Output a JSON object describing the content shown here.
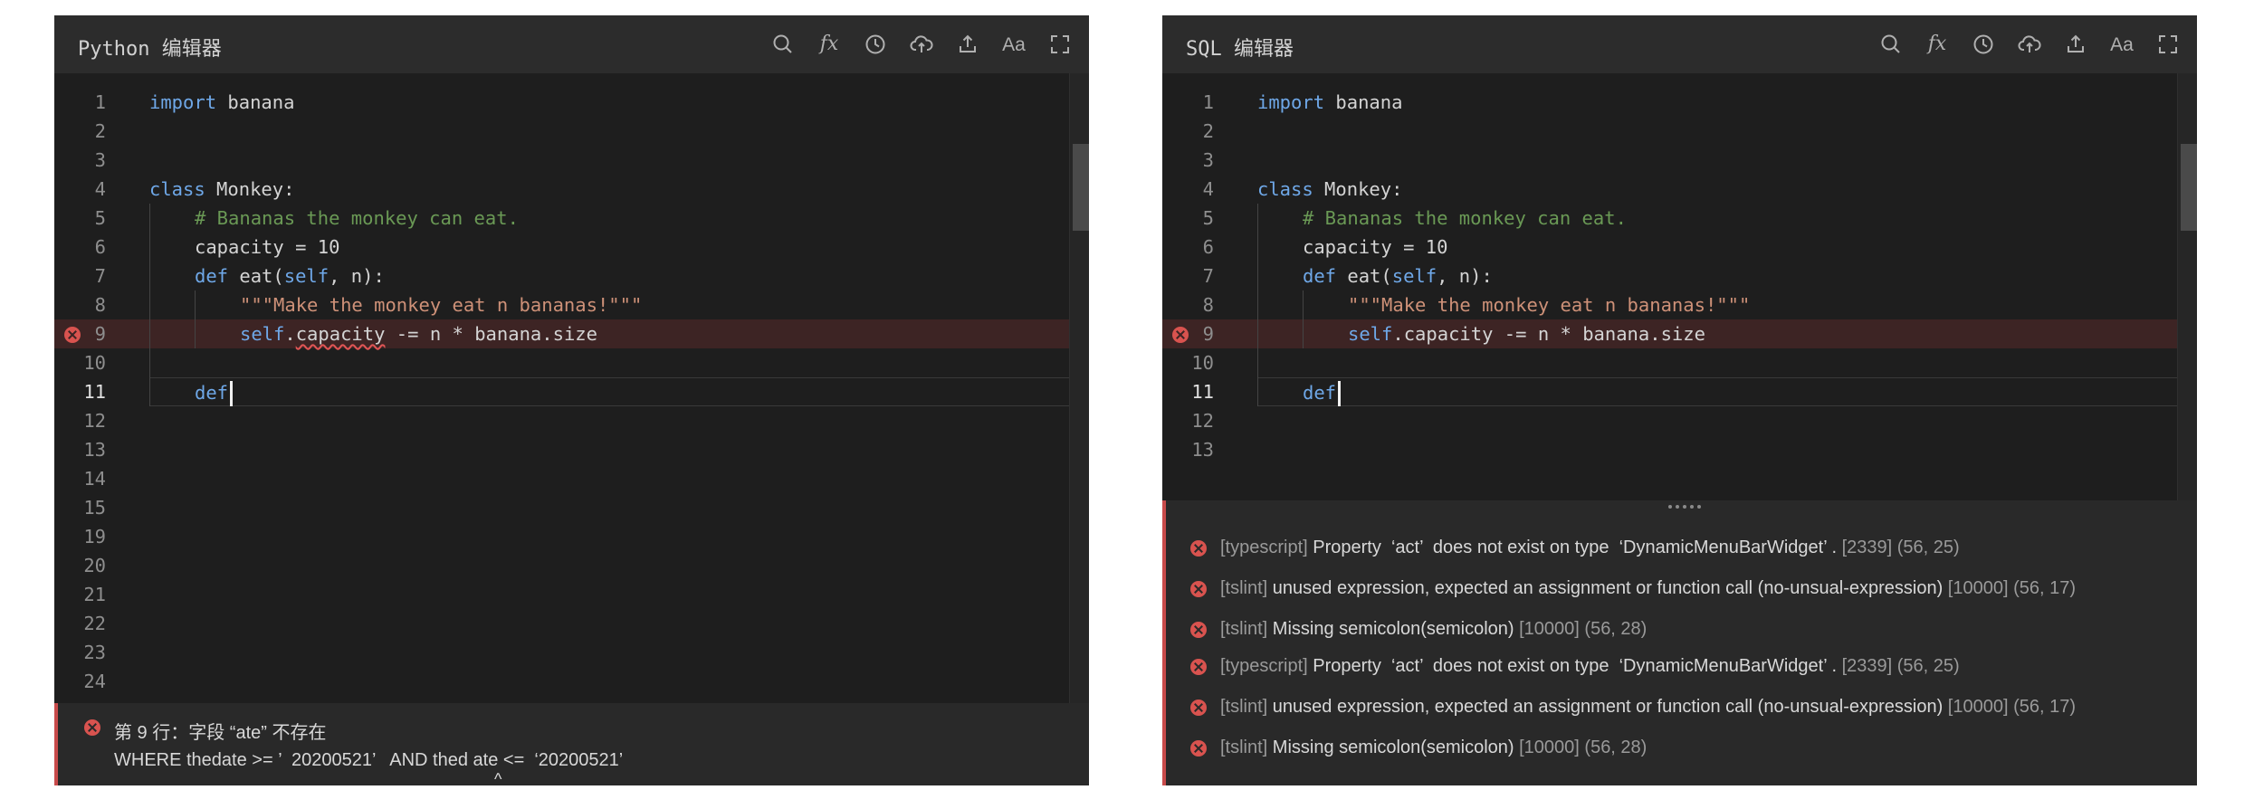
{
  "editors": {
    "python": {
      "title": "Python 编辑器",
      "lines": {
        "l1": {
          "num": "1",
          "kw": "import",
          "rest": " banana"
        },
        "l2": {
          "num": "2"
        },
        "l3": {
          "num": "3"
        },
        "l4": {
          "num": "4",
          "kw": "class",
          "rest": " Monkey:"
        },
        "l5": {
          "num": "5",
          "comment": "# Bananas the monkey can eat."
        },
        "l6": {
          "num": "6",
          "text": "capacity = 10"
        },
        "l7": {
          "num": "7",
          "kw": "def",
          "rest": " eat(",
          "self": "self",
          "rest2": ", n):"
        },
        "l8": {
          "num": "8",
          "string": "\"\"\"Make the monkey eat n bananas!\"\"\""
        },
        "l9": {
          "num": "9",
          "self": "self",
          "dot": ".",
          "err_word": "capacity",
          "rest": " -= n * banana.size"
        },
        "l10": {
          "num": "10"
        },
        "l11": {
          "num": "11",
          "kw": "def"
        },
        "l12": {
          "num": "12"
        },
        "l13": {
          "num": "13"
        },
        "l14": {
          "num": "14"
        },
        "l15": {
          "num": "15"
        },
        "l19": {
          "num": "19"
        },
        "l20": {
          "num": "20"
        },
        "l21": {
          "num": "21"
        },
        "l22": {
          "num": "22"
        },
        "l23": {
          "num": "23"
        },
        "l24": {
          "num": "24"
        }
      },
      "error_status": {
        "title": "第 9 行：字段 “ate” 不存在",
        "sql": "WHERE thedate >= ’  20200521’   AND thed ate <=  ‘20200521’",
        "caret": "^"
      }
    },
    "sql": {
      "title": "SQL 编辑器",
      "lines": {
        "l1": {
          "num": "1",
          "kw": "import",
          "rest": " banana"
        },
        "l2": {
          "num": "2"
        },
        "l3": {
          "num": "3"
        },
        "l4": {
          "num": "4",
          "kw": "class",
          "rest": " Monkey:"
        },
        "l5": {
          "num": "5",
          "comment": "# Bananas the monkey can eat."
        },
        "l6": {
          "num": "6",
          "text": "capacity = 10"
        },
        "l7": {
          "num": "7",
          "kw": "def",
          "rest": " eat(",
          "self": "self",
          "rest2": ", n):"
        },
        "l8": {
          "num": "8",
          "string": "\"\"\"Make the monkey eat n bananas!\"\"\""
        },
        "l9": {
          "num": "9",
          "self": "self",
          "rest": ".capacity -= n * banana.size"
        },
        "l10": {
          "num": "10"
        },
        "l11": {
          "num": "11",
          "kw": "def"
        },
        "l12": {
          "num": "12"
        },
        "l13": {
          "num": "13"
        }
      },
      "problems": [
        {
          "source": "[typescript]",
          "message": " Property  ‘act’  does not exist on type  ‘DynamicMenuBarWidget’ .",
          "code": " [2339] (56, 25)"
        },
        {
          "source": "[tslint]",
          "message": " unused expression, expected an assignment or function call (no-unsual-expression)",
          "code": " [10000] (56, 17)"
        },
        {
          "source": "[tslint]",
          "message": " Missing semicolon(semicolon)",
          "code": " [10000] (56, 28)"
        },
        {
          "source": "[typescript]",
          "message": " Property  ‘act’  does not exist on type  ‘DynamicMenuBarWidget’ .",
          "code": " [2339] (56, 25)"
        },
        {
          "source": "[tslint]",
          "message": " unused expression, expected an assignment or function call (no-unsual-expression)",
          "code": " [10000] (56, 17)"
        },
        {
          "source": "[tslint]",
          "message": " Missing semicolon(semicolon)",
          "code": " [10000] (56, 28)"
        }
      ]
    }
  },
  "toolbar": {
    "icons": [
      "search-icon",
      "function-icon",
      "history-icon",
      "cloud-upload-icon",
      "upload-icon",
      "font-size-icon",
      "fullscreen-icon"
    ],
    "fx_glyph": "fx",
    "aa_label": "Aa"
  },
  "colors": {
    "keyword": "#6fa8e8",
    "comment": "#6a9955",
    "string": "#ce9178",
    "error": "#d9534f",
    "background": "#1e1e1e",
    "header": "#2c2c2c"
  }
}
